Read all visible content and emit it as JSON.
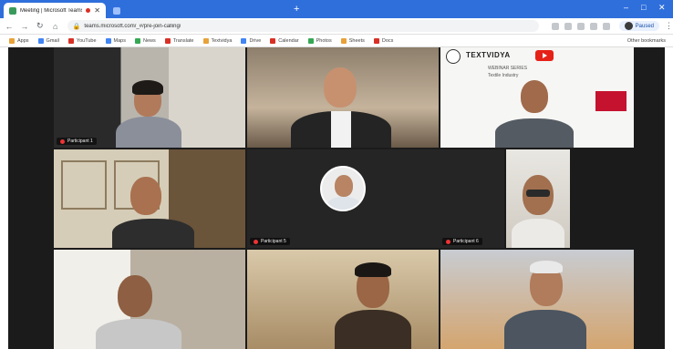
{
  "browser": {
    "tabs": [
      {
        "title": "Meeting | Microsoft Teams",
        "active": true
      },
      {
        "title": "",
        "active": false
      }
    ],
    "new_tab_label": "+",
    "window_controls": {
      "minimize": "–",
      "maximize": "□",
      "close": "✕"
    },
    "toolbar": {
      "back_icon": "arrow-left-icon",
      "forward_icon": "arrow-right-icon",
      "reload_icon": "reload-icon",
      "home_icon": "home-icon",
      "url": "teams.microsoft.com/_#/pre-join-calling/",
      "profile_label": "Paused"
    },
    "bookmarks": [
      "Apps",
      "Gmail",
      "YouTube",
      "Maps",
      "News",
      "Translate",
      "Textvidya",
      "Drive",
      "Calendar",
      "Photos",
      "Sheets",
      "Docs"
    ],
    "other_bookmarks": "Other bookmarks"
  },
  "meeting": {
    "participants": [
      {
        "name": "Participant 1",
        "show_name": true
      },
      {
        "name": "",
        "show_name": false
      },
      {
        "name": "",
        "show_name": false
      },
      {
        "name": "",
        "show_name": false
      },
      {
        "name": "Participant 5",
        "show_name": true
      },
      {
        "name": "Participant 6",
        "show_name": true
      },
      {
        "name": "",
        "show_name": false
      },
      {
        "name": "",
        "show_name": false
      },
      {
        "name": "",
        "show_name": false
      },
      {
        "name": "",
        "show_name": false
      }
    ],
    "presentation": {
      "brand": "TEXTVIDYA",
      "subtitle": "WEBINAR SERIES",
      "line2": "Textile Industry"
    }
  },
  "colors": {
    "tabstrip": "#2f6fdc",
    "tile_bg": "#1b1b1b",
    "accent_red": "#e62117"
  }
}
